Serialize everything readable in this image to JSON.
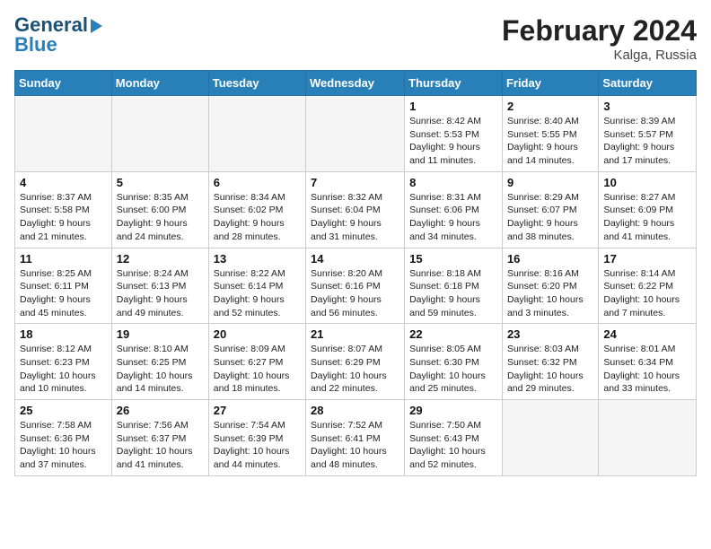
{
  "header": {
    "logo_line1": "General",
    "logo_line2": "Blue",
    "month_title": "February 2024",
    "location": "Kalga, Russia"
  },
  "days_of_week": [
    "Sunday",
    "Monday",
    "Tuesday",
    "Wednesday",
    "Thursday",
    "Friday",
    "Saturday"
  ],
  "weeks": [
    [
      {
        "day": "",
        "info": ""
      },
      {
        "day": "",
        "info": ""
      },
      {
        "day": "",
        "info": ""
      },
      {
        "day": "",
        "info": ""
      },
      {
        "day": "1",
        "info": "Sunrise: 8:42 AM\nSunset: 5:53 PM\nDaylight: 9 hours\nand 11 minutes."
      },
      {
        "day": "2",
        "info": "Sunrise: 8:40 AM\nSunset: 5:55 PM\nDaylight: 9 hours\nand 14 minutes."
      },
      {
        "day": "3",
        "info": "Sunrise: 8:39 AM\nSunset: 5:57 PM\nDaylight: 9 hours\nand 17 minutes."
      }
    ],
    [
      {
        "day": "4",
        "info": "Sunrise: 8:37 AM\nSunset: 5:58 PM\nDaylight: 9 hours\nand 21 minutes."
      },
      {
        "day": "5",
        "info": "Sunrise: 8:35 AM\nSunset: 6:00 PM\nDaylight: 9 hours\nand 24 minutes."
      },
      {
        "day": "6",
        "info": "Sunrise: 8:34 AM\nSunset: 6:02 PM\nDaylight: 9 hours\nand 28 minutes."
      },
      {
        "day": "7",
        "info": "Sunrise: 8:32 AM\nSunset: 6:04 PM\nDaylight: 9 hours\nand 31 minutes."
      },
      {
        "day": "8",
        "info": "Sunrise: 8:31 AM\nSunset: 6:06 PM\nDaylight: 9 hours\nand 34 minutes."
      },
      {
        "day": "9",
        "info": "Sunrise: 8:29 AM\nSunset: 6:07 PM\nDaylight: 9 hours\nand 38 minutes."
      },
      {
        "day": "10",
        "info": "Sunrise: 8:27 AM\nSunset: 6:09 PM\nDaylight: 9 hours\nand 41 minutes."
      }
    ],
    [
      {
        "day": "11",
        "info": "Sunrise: 8:25 AM\nSunset: 6:11 PM\nDaylight: 9 hours\nand 45 minutes."
      },
      {
        "day": "12",
        "info": "Sunrise: 8:24 AM\nSunset: 6:13 PM\nDaylight: 9 hours\nand 49 minutes."
      },
      {
        "day": "13",
        "info": "Sunrise: 8:22 AM\nSunset: 6:14 PM\nDaylight: 9 hours\nand 52 minutes."
      },
      {
        "day": "14",
        "info": "Sunrise: 8:20 AM\nSunset: 6:16 PM\nDaylight: 9 hours\nand 56 minutes."
      },
      {
        "day": "15",
        "info": "Sunrise: 8:18 AM\nSunset: 6:18 PM\nDaylight: 9 hours\nand 59 minutes."
      },
      {
        "day": "16",
        "info": "Sunrise: 8:16 AM\nSunset: 6:20 PM\nDaylight: 10 hours\nand 3 minutes."
      },
      {
        "day": "17",
        "info": "Sunrise: 8:14 AM\nSunset: 6:22 PM\nDaylight: 10 hours\nand 7 minutes."
      }
    ],
    [
      {
        "day": "18",
        "info": "Sunrise: 8:12 AM\nSunset: 6:23 PM\nDaylight: 10 hours\nand 10 minutes."
      },
      {
        "day": "19",
        "info": "Sunrise: 8:10 AM\nSunset: 6:25 PM\nDaylight: 10 hours\nand 14 minutes."
      },
      {
        "day": "20",
        "info": "Sunrise: 8:09 AM\nSunset: 6:27 PM\nDaylight: 10 hours\nand 18 minutes."
      },
      {
        "day": "21",
        "info": "Sunrise: 8:07 AM\nSunset: 6:29 PM\nDaylight: 10 hours\nand 22 minutes."
      },
      {
        "day": "22",
        "info": "Sunrise: 8:05 AM\nSunset: 6:30 PM\nDaylight: 10 hours\nand 25 minutes."
      },
      {
        "day": "23",
        "info": "Sunrise: 8:03 AM\nSunset: 6:32 PM\nDaylight: 10 hours\nand 29 minutes."
      },
      {
        "day": "24",
        "info": "Sunrise: 8:01 AM\nSunset: 6:34 PM\nDaylight: 10 hours\nand 33 minutes."
      }
    ],
    [
      {
        "day": "25",
        "info": "Sunrise: 7:58 AM\nSunset: 6:36 PM\nDaylight: 10 hours\nand 37 minutes."
      },
      {
        "day": "26",
        "info": "Sunrise: 7:56 AM\nSunset: 6:37 PM\nDaylight: 10 hours\nand 41 minutes."
      },
      {
        "day": "27",
        "info": "Sunrise: 7:54 AM\nSunset: 6:39 PM\nDaylight: 10 hours\nand 44 minutes."
      },
      {
        "day": "28",
        "info": "Sunrise: 7:52 AM\nSunset: 6:41 PM\nDaylight: 10 hours\nand 48 minutes."
      },
      {
        "day": "29",
        "info": "Sunrise: 7:50 AM\nSunset: 6:43 PM\nDaylight: 10 hours\nand 52 minutes."
      },
      {
        "day": "",
        "info": ""
      },
      {
        "day": "",
        "info": ""
      }
    ]
  ]
}
